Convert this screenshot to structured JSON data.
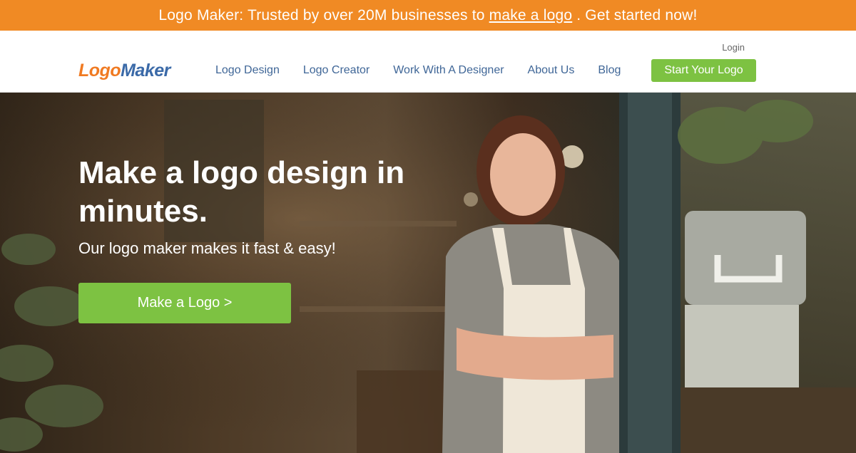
{
  "promo": {
    "prefix": "Logo Maker: Trusted by over 20M businesses to",
    "link": "make a logo",
    "suffix": ". Get started now!"
  },
  "header": {
    "login": "Login",
    "logo_part1": "Logo",
    "logo_part2": "Maker",
    "nav": [
      "Logo Design",
      "Logo Creator",
      "Work With A Designer",
      "About Us",
      "Blog"
    ],
    "cta": "Start Your Logo"
  },
  "hero": {
    "title": "Make a logo design in minutes.",
    "subtitle": "Our logo maker makes it fast & easy!",
    "button": "Make a Logo >"
  },
  "colors": {
    "promo_bg": "#f08a24",
    "cta_green": "#7dc242",
    "nav_blue": "#3f6697",
    "logo_orange": "#f07a22",
    "logo_blue": "#3b6aa8"
  }
}
